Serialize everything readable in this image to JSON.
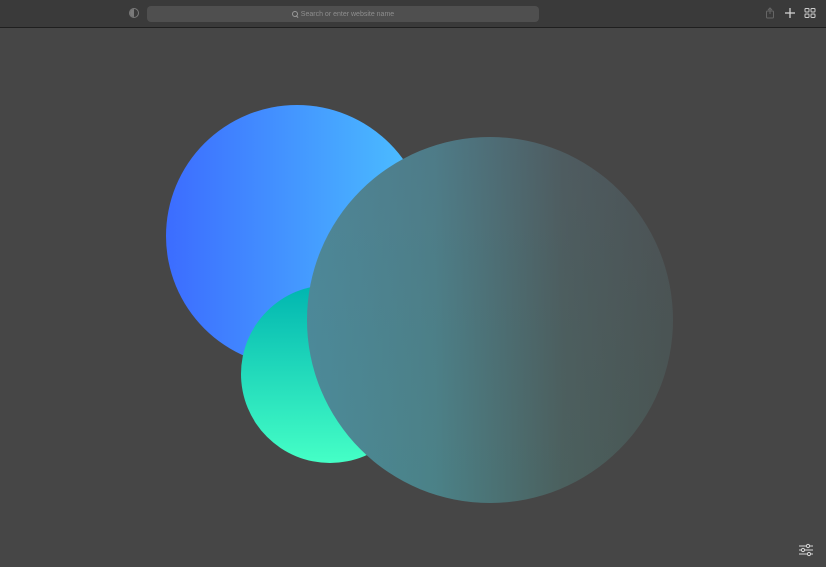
{
  "browser": {
    "address_bar": {
      "placeholder": "Search or enter website name"
    },
    "icons": {
      "sidebar": "sidebar-toggle-icon",
      "search": "magnifier-icon",
      "share": "share-icon",
      "new_tab": "plus-icon",
      "tab_overview": "tab-overview-icon"
    }
  },
  "page": {
    "background_color": "#464646",
    "corner_icon": "sliders-icon",
    "circles_colors": {
      "blue_start": "#3c6cff",
      "blue_end": "#4cc3ff",
      "teal_top": "#00b5b0",
      "mint_bottom": "#45ffc6",
      "slate_overlay": "#4a7f8a"
    }
  }
}
